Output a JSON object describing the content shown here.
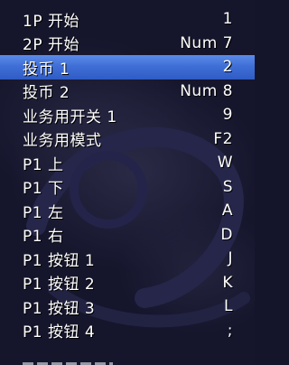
{
  "menu": {
    "items": [
      {
        "label": "1P 开始",
        "key": "1",
        "selected": false
      },
      {
        "label": "2P 开始",
        "key": "Num 7",
        "selected": false
      },
      {
        "label": "投币 1",
        "key": "2",
        "selected": true
      },
      {
        "label": "投币 2",
        "key": "Num 8",
        "selected": false
      },
      {
        "label": "业务用开关 1",
        "key": "9",
        "selected": false
      },
      {
        "label": "业务用模式",
        "key": "F2",
        "selected": false
      },
      {
        "label": "P1 上",
        "key": "W",
        "selected": false
      },
      {
        "label": "P1 下",
        "key": "S",
        "selected": false
      },
      {
        "label": "P1 左",
        "key": "A",
        "selected": false
      },
      {
        "label": "P1 右",
        "key": "D",
        "selected": false
      },
      {
        "label": "P1 按钮 1",
        "key": "J",
        "selected": false
      },
      {
        "label": "P1 按钮 2",
        "key": "K",
        "selected": false
      },
      {
        "label": "P1 按钮 3",
        "key": "L",
        "selected": false
      },
      {
        "label": "P1 按钮 4",
        "key": ";",
        "selected": false
      }
    ]
  },
  "colors": {
    "background": "#15152c",
    "highlight": "#3f6fd6",
    "text": "#ffffff"
  }
}
